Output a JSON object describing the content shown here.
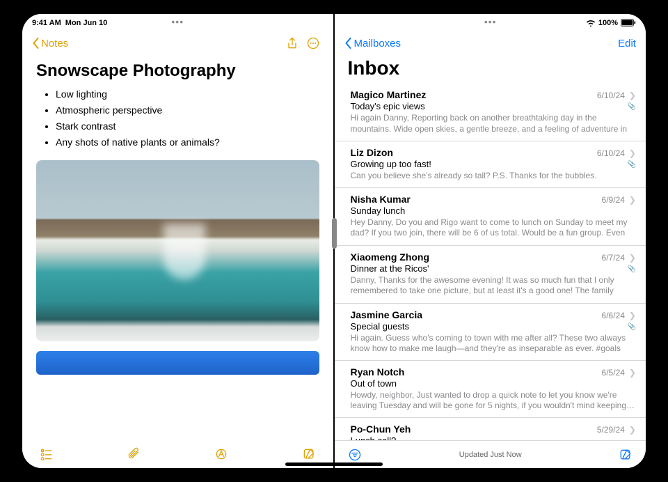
{
  "status": {
    "time": "9:41 AM",
    "date": "Mon Jun 10",
    "battery": "100%"
  },
  "notes": {
    "back_label": "Notes",
    "title": "Snowscape Photography",
    "bullets": [
      "Low lighting",
      "Atmospheric perspective",
      "Stark contrast",
      "Any shots of native plants or animals?"
    ]
  },
  "mail": {
    "back_label": "Mailboxes",
    "edit_label": "Edit",
    "title": "Inbox",
    "footer_status": "Updated Just Now",
    "messages": [
      {
        "from": "Magico Martinez",
        "date": "6/10/24",
        "subject": "Today's epic views",
        "preview": "Hi again Danny, Reporting back on another breathtaking day in the mountains. Wide open skies, a gentle breeze, and a feeling of adventure in the air. I felt l…",
        "attachment": true
      },
      {
        "from": "Liz Dizon",
        "date": "6/10/24",
        "subject": "Growing up too fast!",
        "preview": "Can you believe she's already so tall? P.S. Thanks for the bubbles.",
        "attachment": true
      },
      {
        "from": "Nisha Kumar",
        "date": "6/9/24",
        "subject": "Sunday lunch",
        "preview": "Hey Danny, Do you and Rigo want to come to lunch on Sunday to meet my dad? If you two join, there will be 6 of us total. Would be a fun group. Even if…",
        "attachment": false
      },
      {
        "from": "Xiaomeng Zhong",
        "date": "6/7/24",
        "subject": "Dinner at the Ricos'",
        "preview": "Danny, Thanks for the awesome evening! It was so much fun that I only remembered to take one picture, but at least it's a good one! The family and…",
        "attachment": true
      },
      {
        "from": "Jasmine Garcia",
        "date": "6/6/24",
        "subject": "Special guests",
        "preview": "Hi again. Guess who's coming to town with me after all? These two always know how to make me laugh—and they're as inseparable as ever. #goals",
        "attachment": true
      },
      {
        "from": "Ryan Notch",
        "date": "6/5/24",
        "subject": "Out of town",
        "preview": "Howdy, neighbor, Just wanted to drop a quick note to let you know we're leaving Tuesday and will be gone for 5 nights, if you wouldn't mind keeping…",
        "attachment": false
      },
      {
        "from": "Po-Chun Yeh",
        "date": "5/29/24",
        "subject": "Lunch call?",
        "preview": "",
        "attachment": false
      }
    ]
  }
}
